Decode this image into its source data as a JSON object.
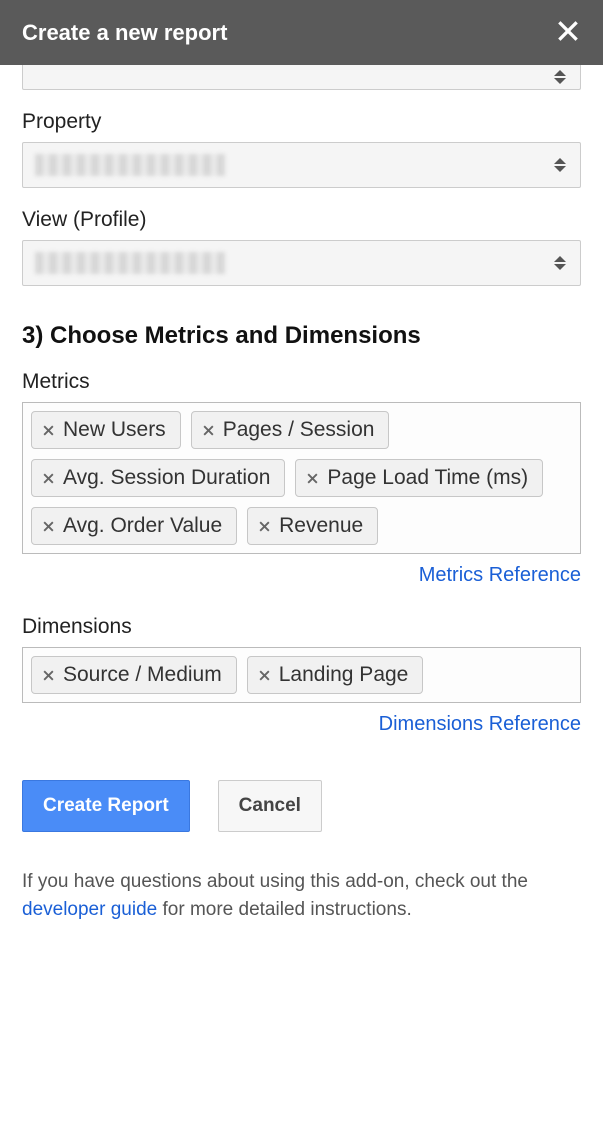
{
  "header": {
    "title": "Create a new report"
  },
  "labels": {
    "property": "Property",
    "view": "View (Profile)",
    "section3": "3) Choose Metrics and Dimensions",
    "metrics": "Metrics",
    "dimensions": "Dimensions"
  },
  "metrics": {
    "items": [
      "New Users",
      "Pages / Session",
      "Avg. Session Duration",
      "Page Load Time (ms)",
      "Avg. Order Value",
      "Revenue"
    ],
    "reference_label": "Metrics Reference"
  },
  "dimensions": {
    "items": [
      "Source / Medium",
      "Landing Page"
    ],
    "reference_label": "Dimensions Reference"
  },
  "buttons": {
    "create": "Create Report",
    "cancel": "Cancel"
  },
  "footer": {
    "pre": "If you have questions about using this add-on, check out the ",
    "link": "developer guide",
    "post": " for more detailed instructions."
  }
}
